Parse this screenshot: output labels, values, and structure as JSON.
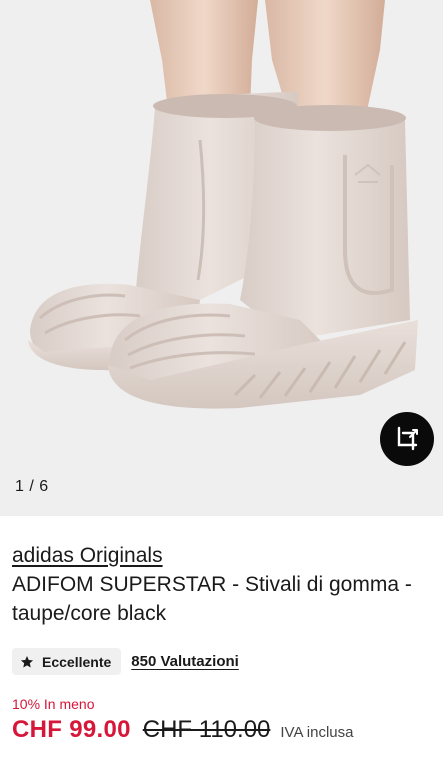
{
  "gallery": {
    "counter": "1 / 6",
    "image_alt": "adidas Originals ADIFOM SUPERSTAR boots in taupe",
    "action_icon": "crop-rotate-icon"
  },
  "product": {
    "brand": "adidas Originals",
    "title": "ADIFOM SUPERSTAR - Stivali di gomma - taupe/core black"
  },
  "rating": {
    "badge_label": "Eccellente",
    "badge_icon": "star-icon",
    "reviews_label": "850 Valutazioni"
  },
  "pricing": {
    "discount_label": "10% In meno",
    "price": "CHF 99.00",
    "original_price": "CHF 110.00",
    "vat_note": "IVA inclusa"
  },
  "colors": {
    "sale": "#d6173a",
    "text": "#1a1a1a",
    "boot": "#e6dcd7"
  }
}
